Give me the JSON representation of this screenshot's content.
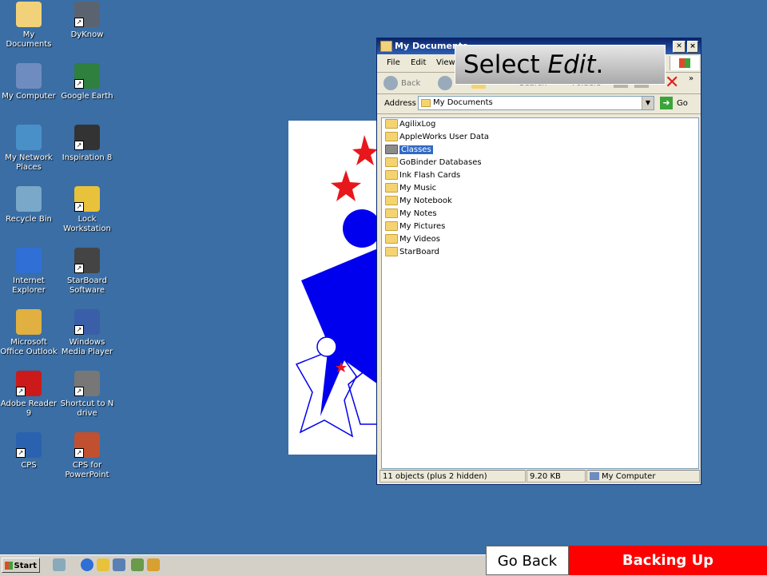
{
  "desktop_icons": [
    {
      "label": "My Documents",
      "icon": "my-documents-icon"
    },
    {
      "label": "DyKnow",
      "icon": "dyknow-icon"
    },
    {
      "label": "My Computer",
      "icon": "my-computer-icon"
    },
    {
      "label": "Google Earth",
      "icon": "google-earth-icon"
    },
    {
      "label": "My Network Places",
      "icon": "network-places-icon"
    },
    {
      "label": "Inspiration 8",
      "icon": "inspiration-icon"
    },
    {
      "label": "Recycle Bin",
      "icon": "recycle-bin-icon"
    },
    {
      "label": "Lock Workstation",
      "icon": "lock-icon"
    },
    {
      "label": "Internet Explorer",
      "icon": "internet-explorer-icon"
    },
    {
      "label": "StarBoard Software",
      "icon": "starboard-icon"
    },
    {
      "label": "Microsoft Office Outlook",
      "icon": "outlook-icon"
    },
    {
      "label": "Windows Media Player",
      "icon": "media-player-icon"
    },
    {
      "label": "Adobe Reader 9",
      "icon": "adobe-reader-icon"
    },
    {
      "label": "Shortcut to N drive",
      "icon": "network-drive-icon"
    },
    {
      "label": "CPS",
      "icon": "cps-icon"
    },
    {
      "label": "CPS for PowerPoint",
      "icon": "cps-powerpoint-icon"
    }
  ],
  "window": {
    "title": "My Documents",
    "menu": [
      "File",
      "Edit",
      "View"
    ],
    "toolbar": {
      "back": "Back",
      "search": "Search",
      "folders": "Folders"
    },
    "address_label": "Address",
    "address_value": "My Documents",
    "go_label": "Go",
    "files": [
      "AgilixLog",
      "AppleWorks User Data",
      "Classes",
      "GoBinder Databases",
      "Ink Flash Cards",
      "My Music",
      "My Notebook",
      "My Notes",
      "My Pictures",
      "My Videos",
      "StarBoard"
    ],
    "selected_file": "Classes",
    "status": {
      "objects": "11 objects (plus 2 hidden)",
      "size": "9.20 KB",
      "location": "My Computer"
    }
  },
  "callout": {
    "prefix": "Select ",
    "emphasis": "Edit",
    "suffix": "."
  },
  "taskbar": {
    "start": "Start"
  },
  "nav": {
    "go_back": "Go Back",
    "backing_up": "Backing Up"
  },
  "colors": {
    "desktop": "#3a6ea5",
    "accent_red": "#ff0000",
    "title_blue": "#0a246a"
  }
}
